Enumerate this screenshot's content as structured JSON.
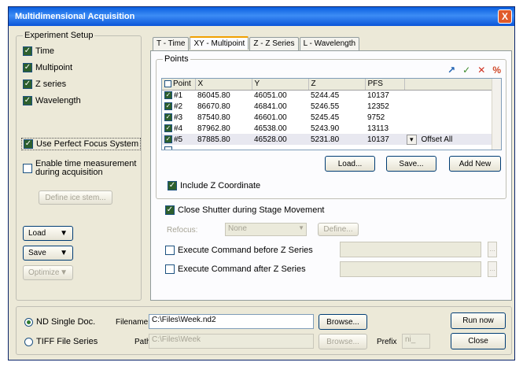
{
  "window": {
    "title": "Multidimensional Acquisition",
    "close_glyph": "X"
  },
  "experiment_setup": {
    "title": "Experiment Setup",
    "items": [
      {
        "label": "Time",
        "checked": true
      },
      {
        "label": "Multipoint",
        "checked": true
      },
      {
        "label": "Z series",
        "checked": true
      },
      {
        "label": "Wavelength",
        "checked": true
      }
    ],
    "pfs_label": "Use Perfect Focus System",
    "time_measure_label_1": "Enable time measurement",
    "time_measure_label_2": "during acquisition",
    "define_button": "Define ice stem...",
    "load_button": "Load",
    "save_button": "Save",
    "optimize_button": "Optimize"
  },
  "tabs": [
    {
      "label": "T - Time",
      "active": false
    },
    {
      "label": "XY - Multipoint",
      "active": true
    },
    {
      "label": "Z - Z Series",
      "active": false
    },
    {
      "label": "L - Wavelength",
      "active": false
    }
  ],
  "points": {
    "group_title": "Points",
    "columns": [
      "Point",
      "X",
      "Y",
      "Z",
      "PFS"
    ],
    "rows": [
      {
        "point": "#1",
        "x": "86045.80",
        "y": "46051.00",
        "z": "5244.45",
        "pfs": "10137",
        "selected": false
      },
      {
        "point": "#2",
        "x": "86670.80",
        "y": "46841.00",
        "z": "5246.55",
        "pfs": "12352",
        "selected": false
      },
      {
        "point": "#3",
        "x": "87540.80",
        "y": "46601.00",
        "z": "5245.45",
        "pfs": "9752",
        "selected": false
      },
      {
        "point": "#4",
        "x": "87962.80",
        "y": "46538.00",
        "z": "5243.90",
        "pfs": "13113",
        "selected": false
      },
      {
        "point": "#5",
        "x": "87885.80",
        "y": "46528.00",
        "z": "5231.80",
        "pfs": "10137",
        "selected": true
      }
    ],
    "offset_all": "Offset All",
    "load_button": "Load...",
    "save_button": "Save...",
    "add_new_button": "Add New",
    "include_z_label": "Include Z Coordinate"
  },
  "options": {
    "close_shutter_label": "Close Shutter during Stage Movement",
    "refocus_label": "Refocus:",
    "refocus_value": "None",
    "define_button": "Define...",
    "exec_before_label": "Execute Command before Z Series",
    "exec_after_label": "Execute Command after Z Series"
  },
  "output": {
    "nd_single_label": "ND Single Doc.",
    "tiff_label": "TIFF File Series",
    "filename_label": "Filename",
    "filename_value": "C:\\Files\\Week.nd2",
    "browse_button": "Browse...",
    "path_label": "Path",
    "path_value": "C:\\Files\\Week",
    "browse2_button": "Browse...",
    "prefix_label": "Prefix",
    "prefix_value": "ni_",
    "run_button": "Run now",
    "close_button": "Close"
  }
}
